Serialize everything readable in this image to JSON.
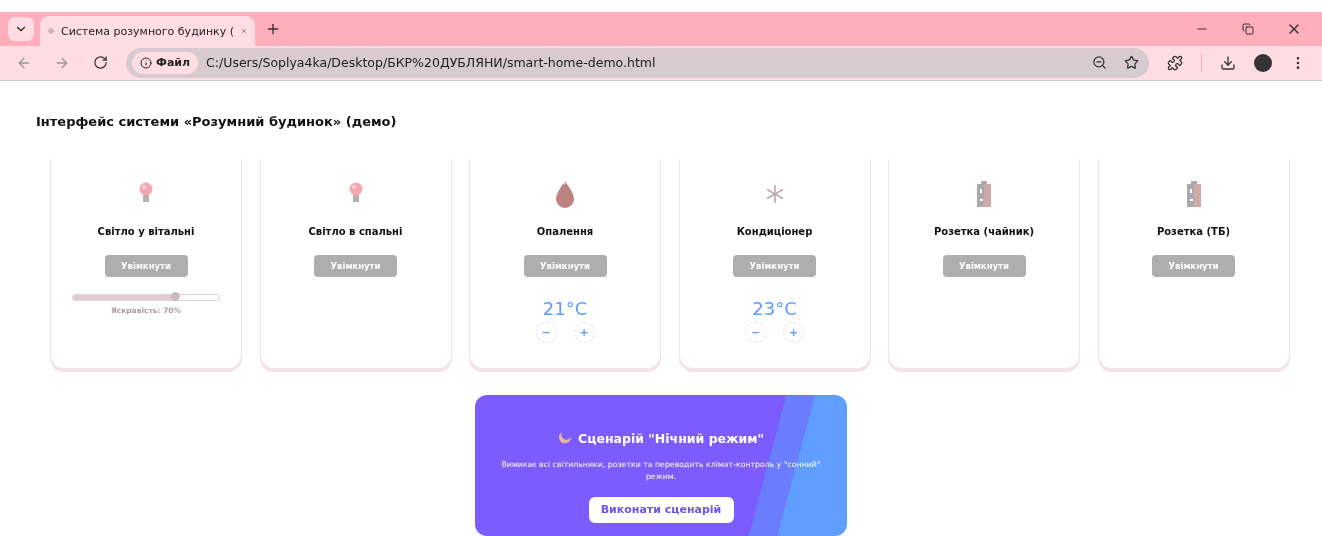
{
  "browser": {
    "tab_title": "Система розумного будинку (",
    "chip": "Файл",
    "url": "C:/Users/Soplya4ka/Desktop/БКР%20ДУБЛЯНИ/smart-home-demo.html"
  },
  "page_title": "Інтерфейс системи «Розумний будинок» (демо)",
  "devices": [
    {
      "kind": "light",
      "name": "Світло у вітальні",
      "button": "Увімкнути",
      "on": false,
      "level": 0.7,
      "reading": "Яскравість: 70%"
    },
    {
      "kind": "light",
      "name": "Світло в спальні",
      "button": "Увімкнути",
      "on": false
    },
    {
      "kind": "heating",
      "name": "Опалення",
      "button": "Увімкнути",
      "on": false,
      "temperature": "21°C",
      "minus": "−",
      "plus": "+"
    },
    {
      "kind": "cooling",
      "name": "Кондиціонер",
      "button": "Увімкнути",
      "on": false,
      "temperature": "23°C",
      "minus": "−",
      "plus": "+"
    },
    {
      "kind": "socket",
      "name": "Розетка (чайник)",
      "button": "Увімкнути",
      "on": false
    },
    {
      "kind": "socket",
      "name": "Розетка (ТБ)",
      "button": "Увімкнути",
      "on": false
    }
  ],
  "scenario": {
    "title": "Сценарій \"Нічний режим\"",
    "description": "Вимикає всі світильники, розетки та переводить клімат-контроль у \"сонний\" режим.",
    "button": "Виконати сценарій"
  }
}
